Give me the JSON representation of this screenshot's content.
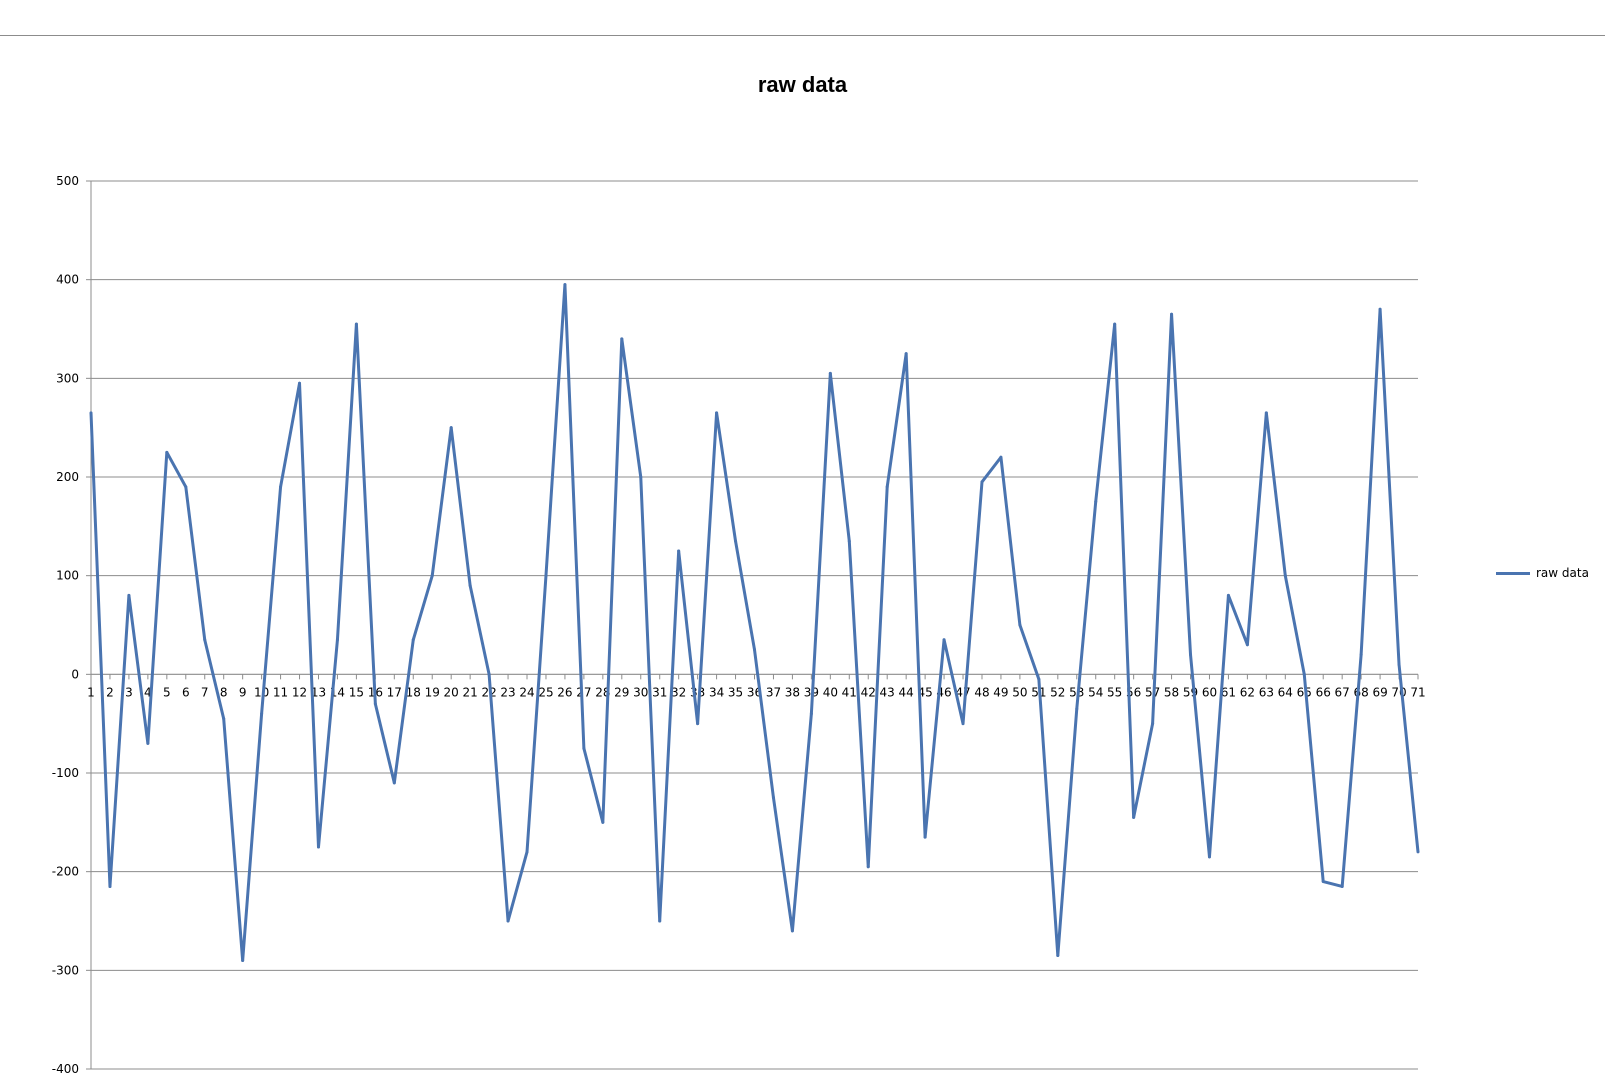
{
  "colors": {
    "series": "#4a74b0",
    "grid": "#8c8c8c",
    "axis": "#8c8c8c"
  },
  "chart_data": {
    "type": "line",
    "title": "raw data",
    "xlabel": "",
    "ylabel": "",
    "ylim": [
      -400,
      500
    ],
    "y_ticks": [
      500,
      400,
      300,
      200,
      100,
      0,
      -100,
      -200,
      -300,
      -400
    ],
    "grid": true,
    "legend_position": "right",
    "x": [
      1,
      2,
      3,
      4,
      5,
      6,
      7,
      8,
      9,
      10,
      11,
      12,
      13,
      14,
      15,
      16,
      17,
      18,
      19,
      20,
      21,
      22,
      23,
      24,
      25,
      26,
      27,
      28,
      29,
      30,
      31,
      32,
      33,
      34,
      35,
      36,
      37,
      38,
      39,
      40,
      41,
      42,
      43,
      44,
      45,
      46,
      47,
      48,
      49,
      50,
      51,
      52,
      53,
      54,
      55,
      56,
      57,
      58,
      59,
      60,
      61,
      62,
      63,
      64,
      65,
      66,
      67,
      68,
      69,
      70,
      71
    ],
    "series": [
      {
        "name": "raw data",
        "values": [
          265,
          -215,
          80,
          -70,
          225,
          190,
          35,
          -45,
          -290,
          -40,
          190,
          295,
          -175,
          35,
          355,
          -30,
          -110,
          35,
          100,
          250,
          90,
          0,
          -250,
          -180,
          100,
          395,
          -75,
          -150,
          340,
          200,
          -250,
          125,
          -50,
          265,
          135,
          25,
          -125,
          -260,
          -40,
          305,
          135,
          -195,
          190,
          325,
          -165,
          35,
          -50,
          195,
          220,
          50,
          -5,
          -285,
          -35,
          175,
          355,
          -145,
          -50,
          365,
          20,
          -185,
          80,
          30,
          265,
          100,
          0,
          -210,
          -215,
          20,
          370,
          10,
          -180
        ]
      }
    ]
  }
}
